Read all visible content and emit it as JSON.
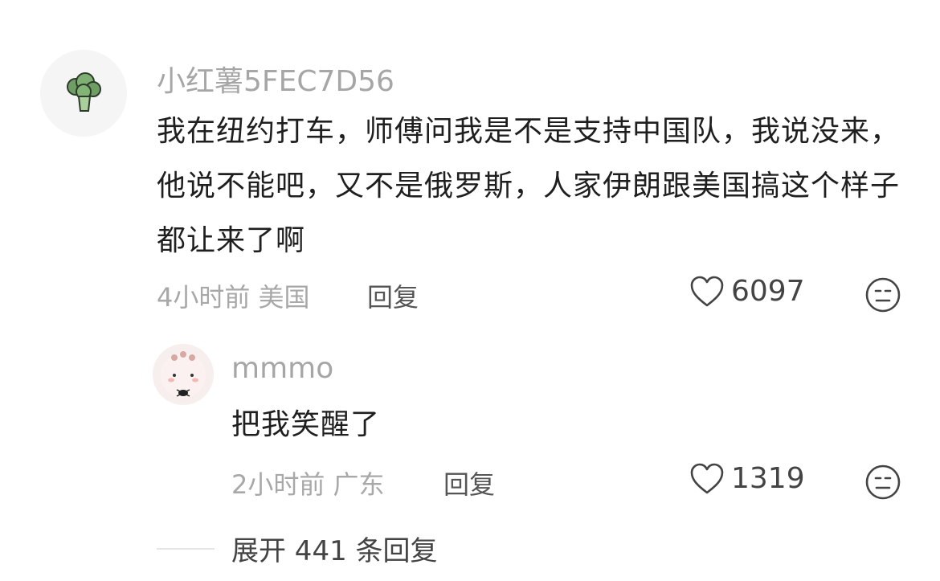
{
  "comment": {
    "username": "小红薯5FEC7D56",
    "text": "我在纽约打车，师傅问我是不是支持中国队，我说没来，他说不能吧，又不是俄罗斯，人家伊朗跟美国搞这个样子都让来了啊",
    "time_location": "4小时前 美国",
    "reply_label": "回复",
    "likes": "6097",
    "avatar_icon": "broccoli-icon",
    "reply": {
      "username": "mmmo",
      "text": "把我笑醒了",
      "time_location": "2小时前 广东",
      "reply_label": "回复",
      "likes": "1319",
      "avatar_icon": "cartoon-avatar-icon"
    }
  },
  "expand": {
    "label": "展开 441 条回复"
  },
  "colors": {
    "meta_gray": "#a8a8a8",
    "text_dark": "#1f1f1f"
  }
}
